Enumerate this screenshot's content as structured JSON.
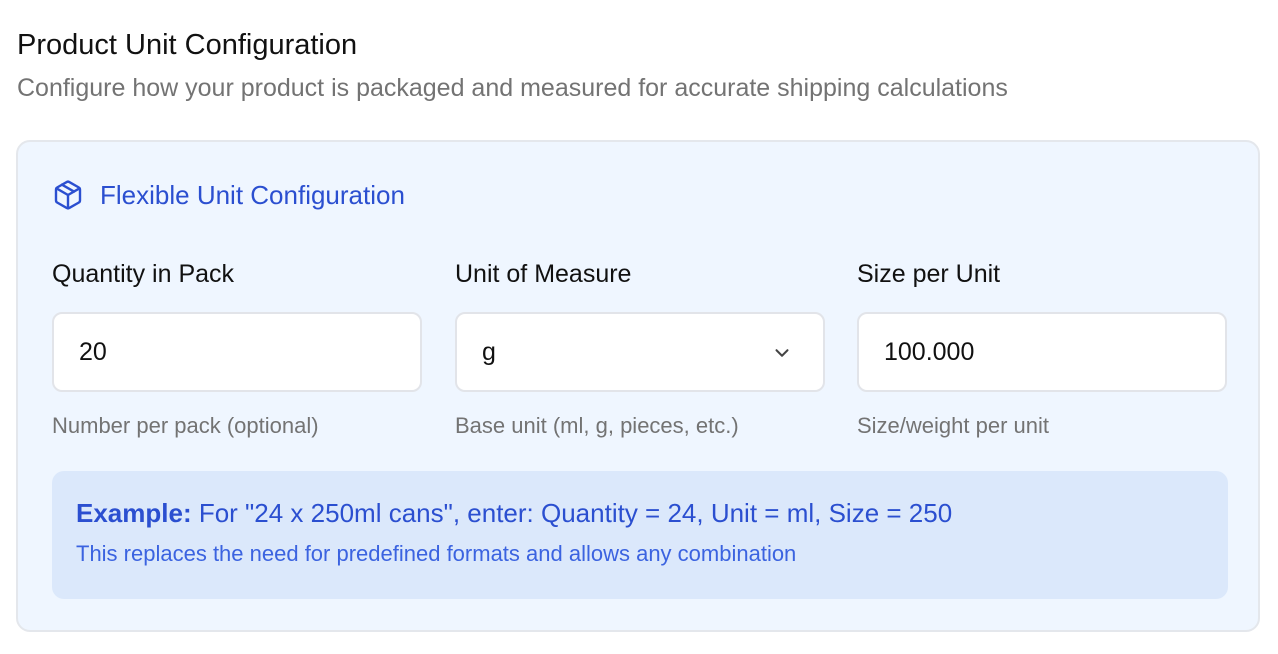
{
  "header": {
    "title": "Product Unit Configuration",
    "subtitle": "Configure how your product is packaged and measured for accurate shipping calculations"
  },
  "card": {
    "icon": "package-icon",
    "title": "Flexible Unit Configuration",
    "accent_color": "#2b4fd0",
    "background_color": "#eff6ff",
    "fields": [
      {
        "label": "Quantity in Pack",
        "value": "20",
        "hint": "Number per pack (optional)"
      },
      {
        "label": "Unit of Measure",
        "value": "g",
        "hint": "Base unit (ml, g, pieces, etc.)"
      },
      {
        "label": "Size per Unit",
        "value": "100.000",
        "hint": "Size/weight per unit"
      }
    ],
    "example": {
      "prefix": "Example:",
      "text": " For \"24 x 250ml cans\", enter: Quantity = 24, Unit = ml, Size = 250",
      "note": "This replaces the need for predefined formats and allows any combination"
    }
  }
}
